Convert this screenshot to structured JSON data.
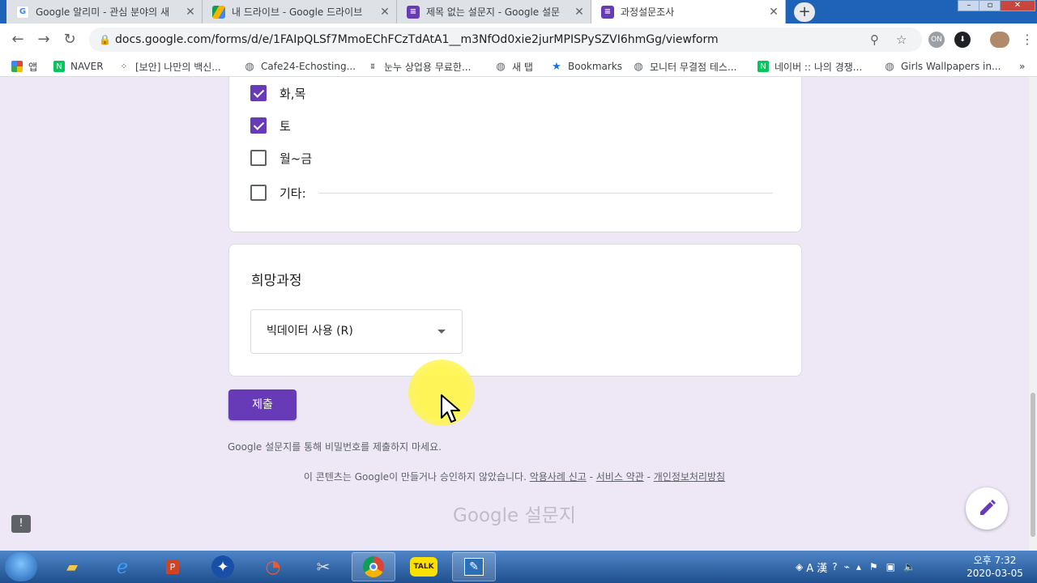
{
  "browser": {
    "tabs": [
      {
        "title": "Google 알리미 - 관심 분야의 새",
        "icon": "google-icon",
        "active": false
      },
      {
        "title": "내 드라이브 - Google 드라이브",
        "icon": "drive-icon",
        "active": false
      },
      {
        "title": "제목 없는 설문지 - Google 설문",
        "icon": "forms-icon",
        "active": false
      },
      {
        "title": "과정설문조사",
        "icon": "forms-icon",
        "active": true
      }
    ],
    "new_tab_label": "+",
    "url": "docs.google.com/forms/d/e/1FAIpQLSf7MmoEChFCzTdAtA1__m3NfOd0xie2jurMPISPySZVI6hmGg/viewform",
    "bookmarks": [
      {
        "label": "앱",
        "icon": "apps-icon"
      },
      {
        "label": "NAVER",
        "icon": "naver-icon"
      },
      {
        "label": "[보안] 나만의 백신...",
        "icon": "dots-icon"
      },
      {
        "label": "Cafe24-Echosting...",
        "icon": "globe-icon"
      },
      {
        "label": "눈누 상업용 무료한...",
        "icon": "noonnu-icon"
      },
      {
        "label": "새 탭",
        "icon": "globe-icon"
      },
      {
        "label": "Bookmarks",
        "icon": "star-icon"
      },
      {
        "label": "모니터 무결점 테스...",
        "icon": "globe-icon"
      },
      {
        "label": "네이버 :: 나의 경쟁...",
        "icon": "naver-icon"
      },
      {
        "label": "Girls Wallpapers in...",
        "icon": "globe-icon"
      }
    ],
    "bookmarks_overflow": "»"
  },
  "form": {
    "checkbox_options": [
      {
        "label": "화,목",
        "checked": true
      },
      {
        "label": "토",
        "checked": true
      },
      {
        "label": "월~금",
        "checked": false
      },
      {
        "label": "기타:",
        "checked": false
      }
    ],
    "question_title": "희망과정",
    "dropdown_value": "빅데이터 사용 (R)",
    "submit_label": "제출",
    "password_warning": "Google 설문지를 통해 비밀번호를 제출하지 마세요.",
    "disclaimer_text": "이 콘텐츠는 Google이 만들거나 승인하지 않았습니다.",
    "abuse_link": "악용사례 신고",
    "terms_link": "서비스 약관",
    "privacy_link": "개인정보처리방침",
    "separator": " - ",
    "brand_text": "Google 설문지",
    "feedback_icon_label": "!"
  },
  "taskbar": {
    "ime_label": "A 漢",
    "clock_time": "오후 7:32",
    "clock_date": "2020-03-05",
    "kakao_label": "TALK"
  },
  "colors": {
    "accent": "#673ab7",
    "page_background": "#ede7f6",
    "highlight": "#fff550"
  }
}
